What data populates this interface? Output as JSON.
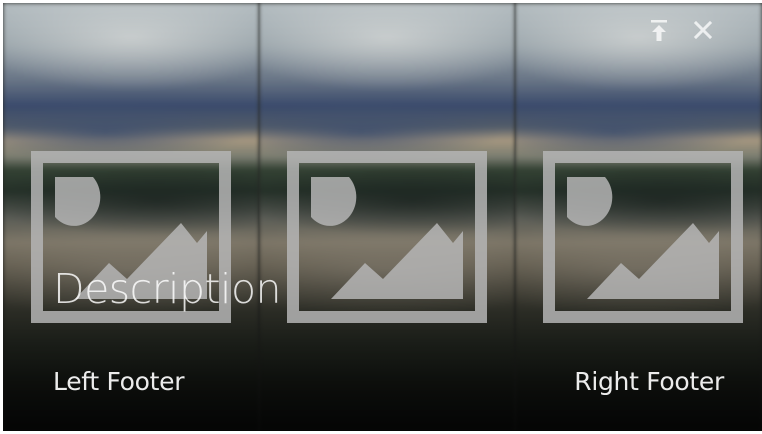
{
  "card": {
    "description": "Description",
    "left_footer": "Left Footer",
    "right_footer": "Right Footer"
  },
  "panels": [
    {
      "icon": "image-placeholder-icon"
    },
    {
      "icon": "image-placeholder-icon"
    },
    {
      "icon": "image-placeholder-icon"
    }
  ],
  "toolbar": {
    "icons": [
      "pin-to-top-icon",
      "close-icon"
    ]
  },
  "colors": {
    "icon_fill": "#b5b5b5",
    "text": "#ffffff"
  }
}
